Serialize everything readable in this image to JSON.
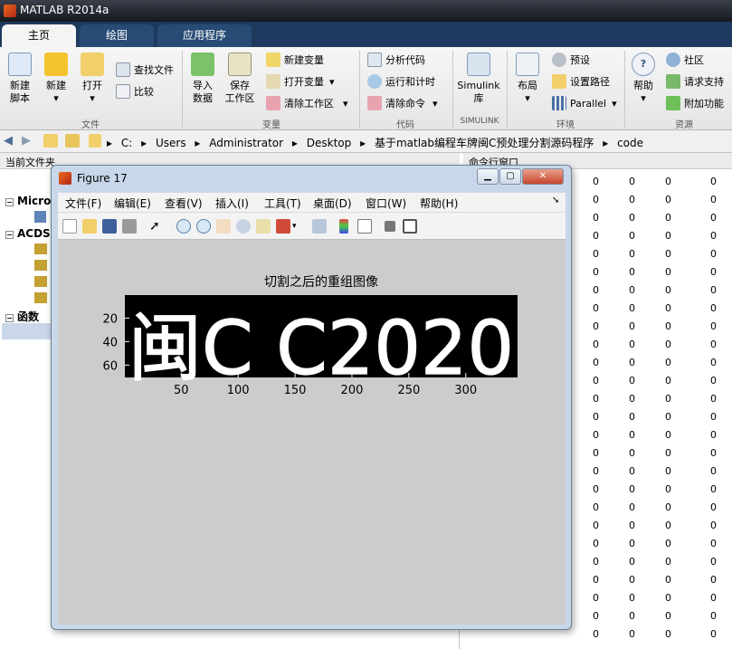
{
  "app": {
    "title": "MATLAB R2014a"
  },
  "tabs": [
    {
      "label": "主页"
    },
    {
      "label": "绘图"
    },
    {
      "label": "应用程序"
    }
  ],
  "ribbon": {
    "file": {
      "new_script": "新建\n脚本",
      "new": "新建",
      "open": "打开",
      "find_files": "查找文件",
      "compare": "比较",
      "section": "文件"
    },
    "variable": {
      "import_data": "导入\n数据",
      "save_workspace": "保存\n工作区",
      "new_variable": "新建变量",
      "open_variable": "打开变量",
      "clear_workspace": "清除工作区",
      "section": "变量"
    },
    "code": {
      "analyze_code": "分析代码",
      "run_and_time": "运行和计时",
      "clear_commands": "清除命令",
      "section": "代码"
    },
    "simulink": {
      "library": "Simulink\n库",
      "section": "SIMULINK"
    },
    "environment": {
      "layout": "布局",
      "preferences": "预设",
      "set_path": "设置路径",
      "parallel": "Parallel",
      "section": "环境"
    },
    "resources": {
      "help": "帮助",
      "community": "社区",
      "request_support": "请求支持",
      "addons": "附加功能",
      "section": "资源"
    }
  },
  "address": {
    "segments": [
      "C:",
      "Users",
      "Administrator",
      "Desktop",
      "基于matlab编程车牌闽C预处理分割源码程序",
      "code"
    ],
    "separator": "▸"
  },
  "left_pane": {
    "title": "当前文件夹",
    "items": [
      "Micro",
      "ACDS",
      "函数"
    ]
  },
  "command_window": {
    "title": "命令行窗口",
    "zero": "0"
  },
  "figure": {
    "title": "Figure 17",
    "menu": [
      "文件(F)",
      "编辑(E)",
      "查看(V)",
      "插入(I)",
      "工具(T)",
      "桌面(D)",
      "窗口(W)",
      "帮助(H)"
    ],
    "plot_title": "切割之后的重组图像",
    "plate_text": "闽C C2020",
    "yticks": [
      "20",
      "40",
      "60"
    ],
    "xticks": [
      "50",
      "100",
      "150",
      "200",
      "250",
      "300"
    ],
    "xlim": [
      0.5,
      345.5
    ],
    "ylim": [
      0.5,
      70.5
    ]
  },
  "colors": {
    "tab_active": "#f4f4f4",
    "figure_frame": "#c8d8ea",
    "plot_bg": "#cccccc"
  }
}
